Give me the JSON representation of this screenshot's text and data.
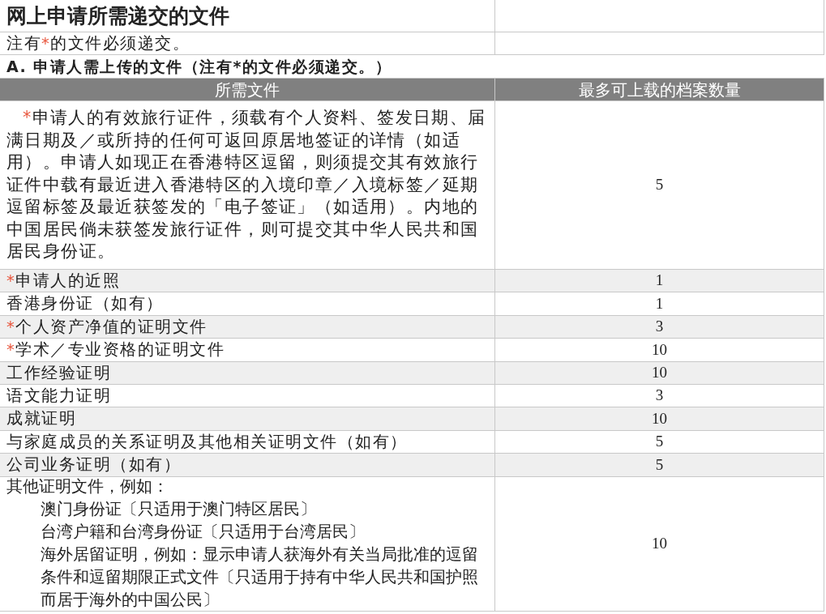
{
  "title": "网上申请所需递交的文件",
  "note": [
    {
      "text": "注有"
    },
    {
      "text": "*",
      "kind": "asterisk"
    },
    {
      "text": "的文件必须递交。"
    }
  ],
  "section": "A. 申请人需上传的文件（注有*的文件必须递交。）",
  "table": {
    "columns": [
      "所需文件",
      "最多可上载的档案数量"
    ],
    "rows": [
      {
        "required": true,
        "document": "申请人的有效旅行证件，须载有个人资料、签发日期、届满日期及／或所持的任何可返回原居地签证的详情（如适用）。申请人如现正在香港特区逗留，则须提交其有效旅行证件中载有最近进入香港特区的入境印章／入境标签／延期逗留标签及最近获签发的「电子签证」（如适用）。内地的中国居民倘未获签发旅行证件，则可提交其中华人民共和国居民身份证。",
        "max_files": "5"
      },
      {
        "required": true,
        "document": "申请人的近照",
        "max_files": "1"
      },
      {
        "required": false,
        "document": "香港身份证（如有）",
        "max_files": "1"
      },
      {
        "required": true,
        "document": "个人资产净值的证明文件",
        "max_files": "3"
      },
      {
        "required": true,
        "document": "学术／专业资格的证明文件",
        "max_files": "10"
      },
      {
        "required": false,
        "document": "工作经验证明",
        "max_files": "10"
      },
      {
        "required": false,
        "document": "语文能力证明",
        "max_files": "3"
      },
      {
        "required": false,
        "document": "成就证明",
        "max_files": "10"
      },
      {
        "required": false,
        "document": "与家庭成员的关系证明及其他相关证明文件（如有）",
        "max_files": "5"
      },
      {
        "required": false,
        "document": "公司业务证明（如有）",
        "max_files": "5"
      },
      {
        "required": false,
        "document": "其他证明文件，例如：",
        "children": [
          "澳门身份证〔只适用于澳门特区居民〕",
          "台湾户籍和台湾身份证〔只适用于台湾居民〕",
          "海外居留证明，例如：显示申请人获海外有关当局批准的逗留条件和逗留期限正式文件〔只适用于持有中华人民共和国护照而居于海外的中国公民〕"
        ],
        "max_files": "10"
      }
    ]
  }
}
